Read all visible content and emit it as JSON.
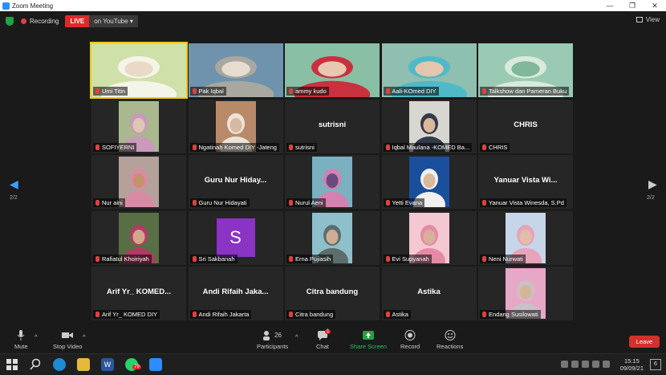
{
  "window": {
    "title": "Zoom Meeting"
  },
  "topbar": {
    "recording_label": "Recording",
    "live_label": "LIVE",
    "youtube_label": "on YouTube ▾",
    "view_label": "View"
  },
  "pager": {
    "left": "2/2",
    "right": "2/2"
  },
  "tiles": [
    {
      "name": "Umi Titin",
      "big": "",
      "kind": "video",
      "colors": [
        "#cfe0a8",
        "#f4f4e8",
        "#e9d9c6"
      ]
    },
    {
      "name": "Pak Iqbal",
      "big": "",
      "kind": "video",
      "colors": [
        "#6f93ad",
        "#a8a8a0",
        "#e6dcd0"
      ]
    },
    {
      "name": "ammy kudo",
      "big": "",
      "kind": "video",
      "colors": [
        "#89bfa5",
        "#c9313f",
        "#e9c8b2"
      ]
    },
    {
      "name": "Aali-KOmed DIY",
      "big": "",
      "kind": "video",
      "colors": [
        "#8fbfb0",
        "#4fb9c8",
        "#e3c6ad"
      ]
    },
    {
      "name": "Talkshow dan Pameran Buku",
      "big": "",
      "kind": "video",
      "colors": [
        "#9ac9b4",
        "#d9eadd",
        "#7fb89a"
      ]
    },
    {
      "name": "SOFIYERNI",
      "big": "",
      "kind": "video",
      "colors": [
        "#aab890",
        "#c99ab9",
        "#dfc5b4"
      ]
    },
    {
      "name": "Ngatinah Komed DIY -Jateng",
      "big": "",
      "kind": "video",
      "colors": [
        "#b98a6a",
        "#ede4d9",
        "#d7b8a0"
      ]
    },
    {
      "name": "sutrisni",
      "big": "sutrisni",
      "kind": "name",
      "colors": []
    },
    {
      "name": "Iqbal Maulana -KOMED Ba...",
      "big": "",
      "kind": "video",
      "colors": [
        "#d8d6d0",
        "#333a48",
        "#dcb89b"
      ]
    },
    {
      "name": "CHRIS",
      "big": "CHRIS",
      "kind": "name",
      "colors": []
    },
    {
      "name": "Nur aini",
      "big": "",
      "kind": "video",
      "colors": [
        "#b4a19a",
        "#d98ba5",
        "#c8916d"
      ]
    },
    {
      "name": "Guru Nur Hidayati",
      "big": "Guru Nur Hiday...",
      "kind": "name",
      "colors": []
    },
    {
      "name": "Nurul Aeni",
      "big": "",
      "kind": "video",
      "colors": [
        "#7ab0c0",
        "#d480b0",
        "#6a4a7c"
      ]
    },
    {
      "name": "Yetti Evana",
      "big": "",
      "kind": "video",
      "colors": [
        "#1a4f9c",
        "#f0f0f0",
        "#d9b89c"
      ]
    },
    {
      "name": "Yanuar Vista Winesda, S.Pd",
      "big": "Yanuar Vista Wi...",
      "kind": "name",
      "colors": []
    },
    {
      "name": "Rafiatul Khoiriyah",
      "big": "",
      "kind": "video",
      "colors": [
        "#5a6e45",
        "#b33a66",
        "#d2a88b"
      ]
    },
    {
      "name": "Sri Sakbanah",
      "big": "",
      "kind": "avatar",
      "colors": []
    },
    {
      "name": "Erna Pujiasih",
      "big": "",
      "kind": "video",
      "colors": [
        "#8ec0cc",
        "#5c6e6c",
        "#cfae95"
      ]
    },
    {
      "name": "Evi Supyanah",
      "big": "",
      "kind": "video",
      "colors": [
        "#f3c8d2",
        "#e48aa7",
        "#d8b09a"
      ]
    },
    {
      "name": "Neni Nurwati",
      "big": "",
      "kind": "video",
      "colors": [
        "#c6d6e8",
        "#e6a3b9",
        "#e1bea8"
      ]
    },
    {
      "name": "Arif Yr_ KOMED DIY",
      "big": "Arif Yr_ KOMED...",
      "kind": "name",
      "colors": []
    },
    {
      "name": "Andi Rifaih Jakarta",
      "big": "Andi Rifaih Jaka...",
      "kind": "name",
      "colors": []
    },
    {
      "name": "Citra bandung",
      "big": "Citra bandung",
      "kind": "name",
      "colors": []
    },
    {
      "name": "Astika",
      "big": "Astika",
      "kind": "name",
      "colors": []
    },
    {
      "name": "Endang Susilowati",
      "big": "",
      "kind": "video",
      "colors": [
        "#e7a8c8",
        "#c9c0c8",
        "#d6b49a"
      ]
    }
  ],
  "avatar_letter": "S",
  "toolbar": {
    "mute": "Mute",
    "stop_video": "Stop Video",
    "participants": "Participants",
    "participants_count": "26",
    "chat": "Chat",
    "chat_badge": "1",
    "share_screen": "Share Screen",
    "record": "Record",
    "reactions": "Reactions",
    "leave": "Leave"
  },
  "taskbar": {
    "time": "15:15",
    "date": "09/09/21",
    "notif_count": "6",
    "whatsapp_badge": "79"
  },
  "colors": {
    "accent_blue": "#2d8cff",
    "live_red": "#e02828",
    "share_green": "#23a244",
    "leave_red": "#d3312c",
    "active_speaker": "#f5c518"
  }
}
